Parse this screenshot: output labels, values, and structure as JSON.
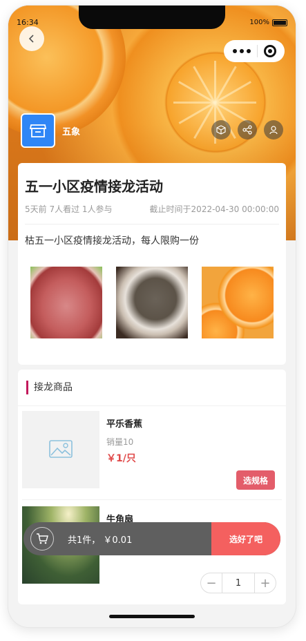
{
  "status": {
    "time": "16:34",
    "battery": "100%"
  },
  "shop": {
    "name": "五象"
  },
  "activity": {
    "title": "五一小区疫情接龙活动",
    "meta": "5天前 7人看过 1人参与",
    "deadline": "截止时间于2022-04-30 00:00:00",
    "description": "枯五一小区疫情接龙活动，每人限购一份"
  },
  "section": {
    "title": "接龙商品"
  },
  "products": [
    {
      "name": "平乐香蕉",
      "sales": "销量10",
      "price": "￥1/只",
      "action": "选规格"
    },
    {
      "name": "牛角扇",
      "quantity": "1"
    }
  ],
  "cart": {
    "summary": "共1件，  ￥0.01",
    "button": "选好了吧"
  },
  "colors": {
    "brand_blue": "#2f86f6",
    "accent_red": "#e35d6a",
    "cart_button": "#f4605f",
    "cart_bar": "#5f5f5f"
  },
  "icons": [
    "back-icon",
    "more-dots-icon",
    "close-circle-icon",
    "store-icon",
    "box-icon",
    "share-icon",
    "user-icon",
    "image-placeholder-icon",
    "cart-icon",
    "minus-icon",
    "plus-icon"
  ]
}
